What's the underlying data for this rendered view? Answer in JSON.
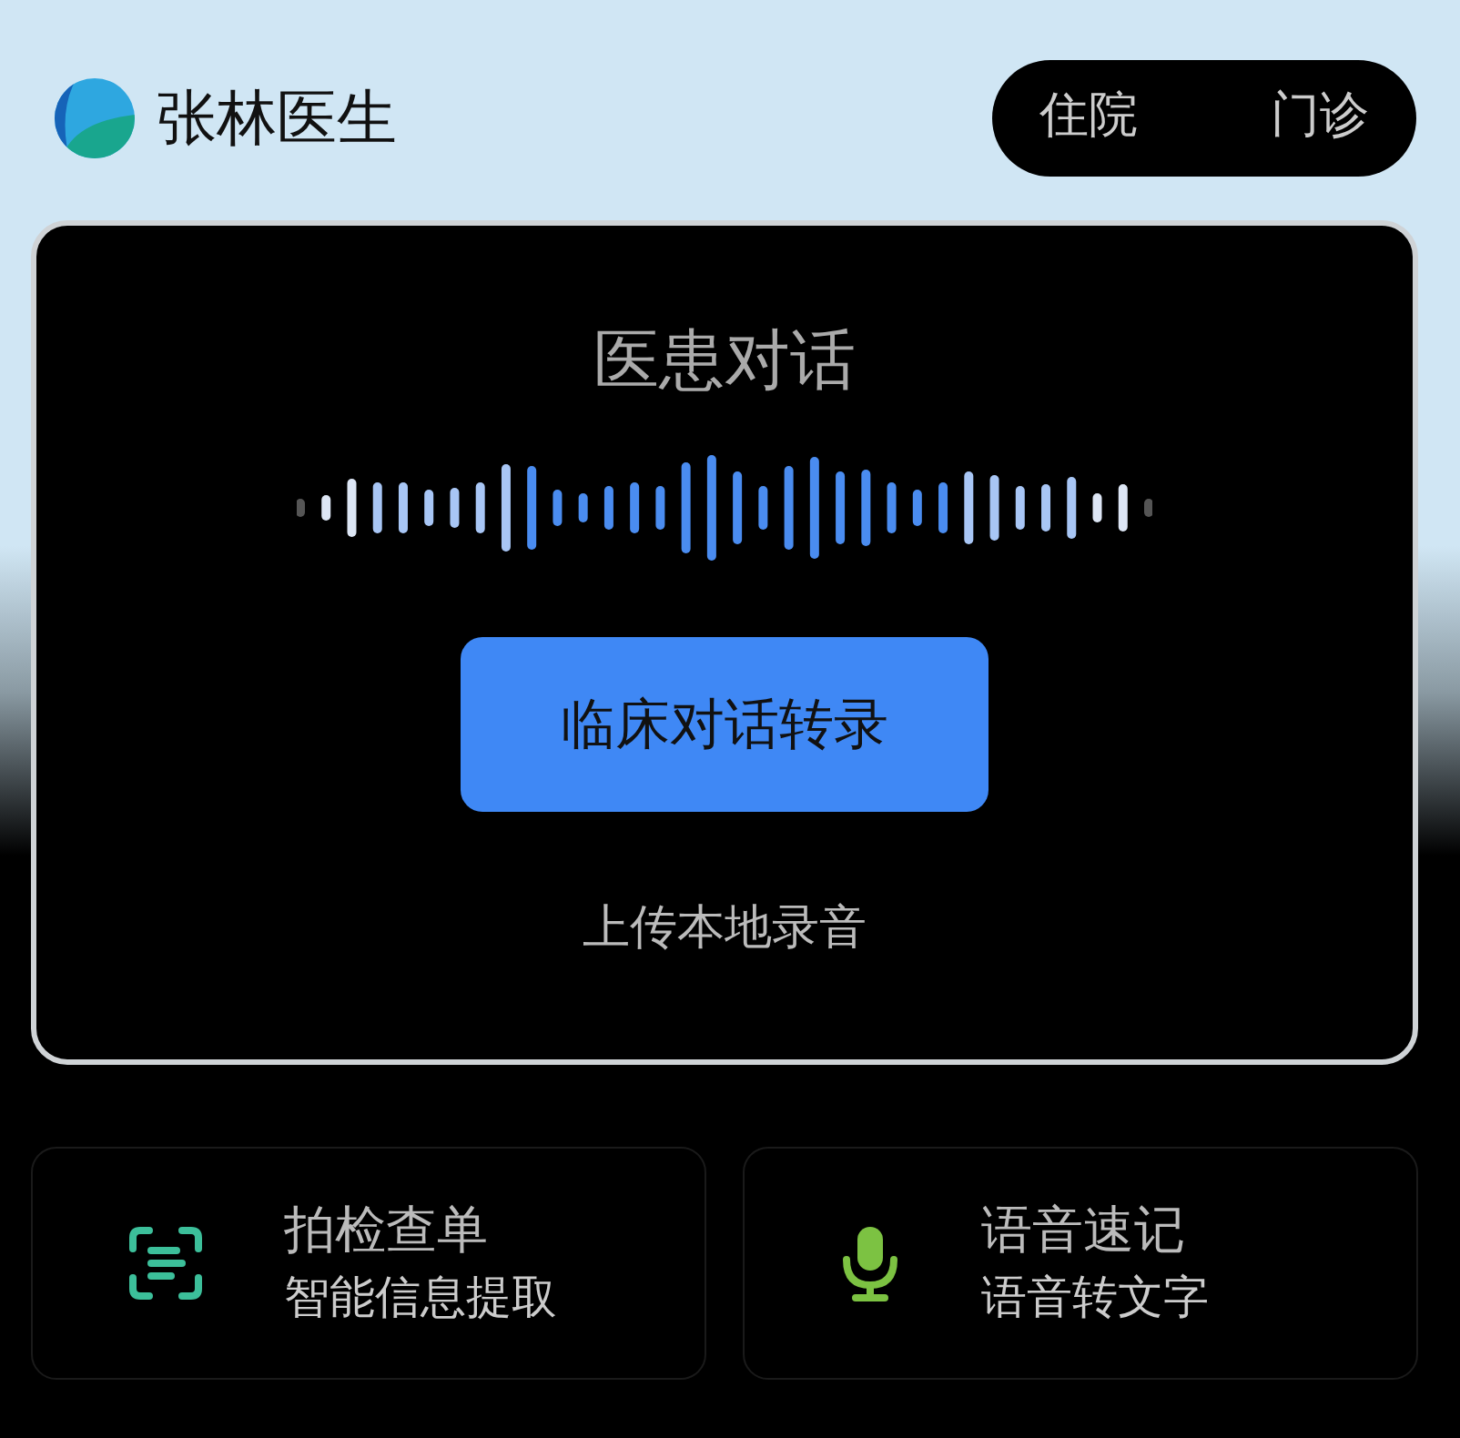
{
  "header": {
    "doctor_name": "张林医生",
    "tabs": [
      {
        "label": "住院"
      },
      {
        "label": "门诊"
      }
    ]
  },
  "main_card": {
    "title": "医患对话",
    "primary_button": "临床对话转录",
    "upload_link": "上传本地录音"
  },
  "features": [
    {
      "kind": "scan",
      "title": "拍检查单",
      "subtitle": "智能信息提取"
    },
    {
      "kind": "mic",
      "title": "语音速记",
      "subtitle": "语音转文字"
    }
  ]
}
